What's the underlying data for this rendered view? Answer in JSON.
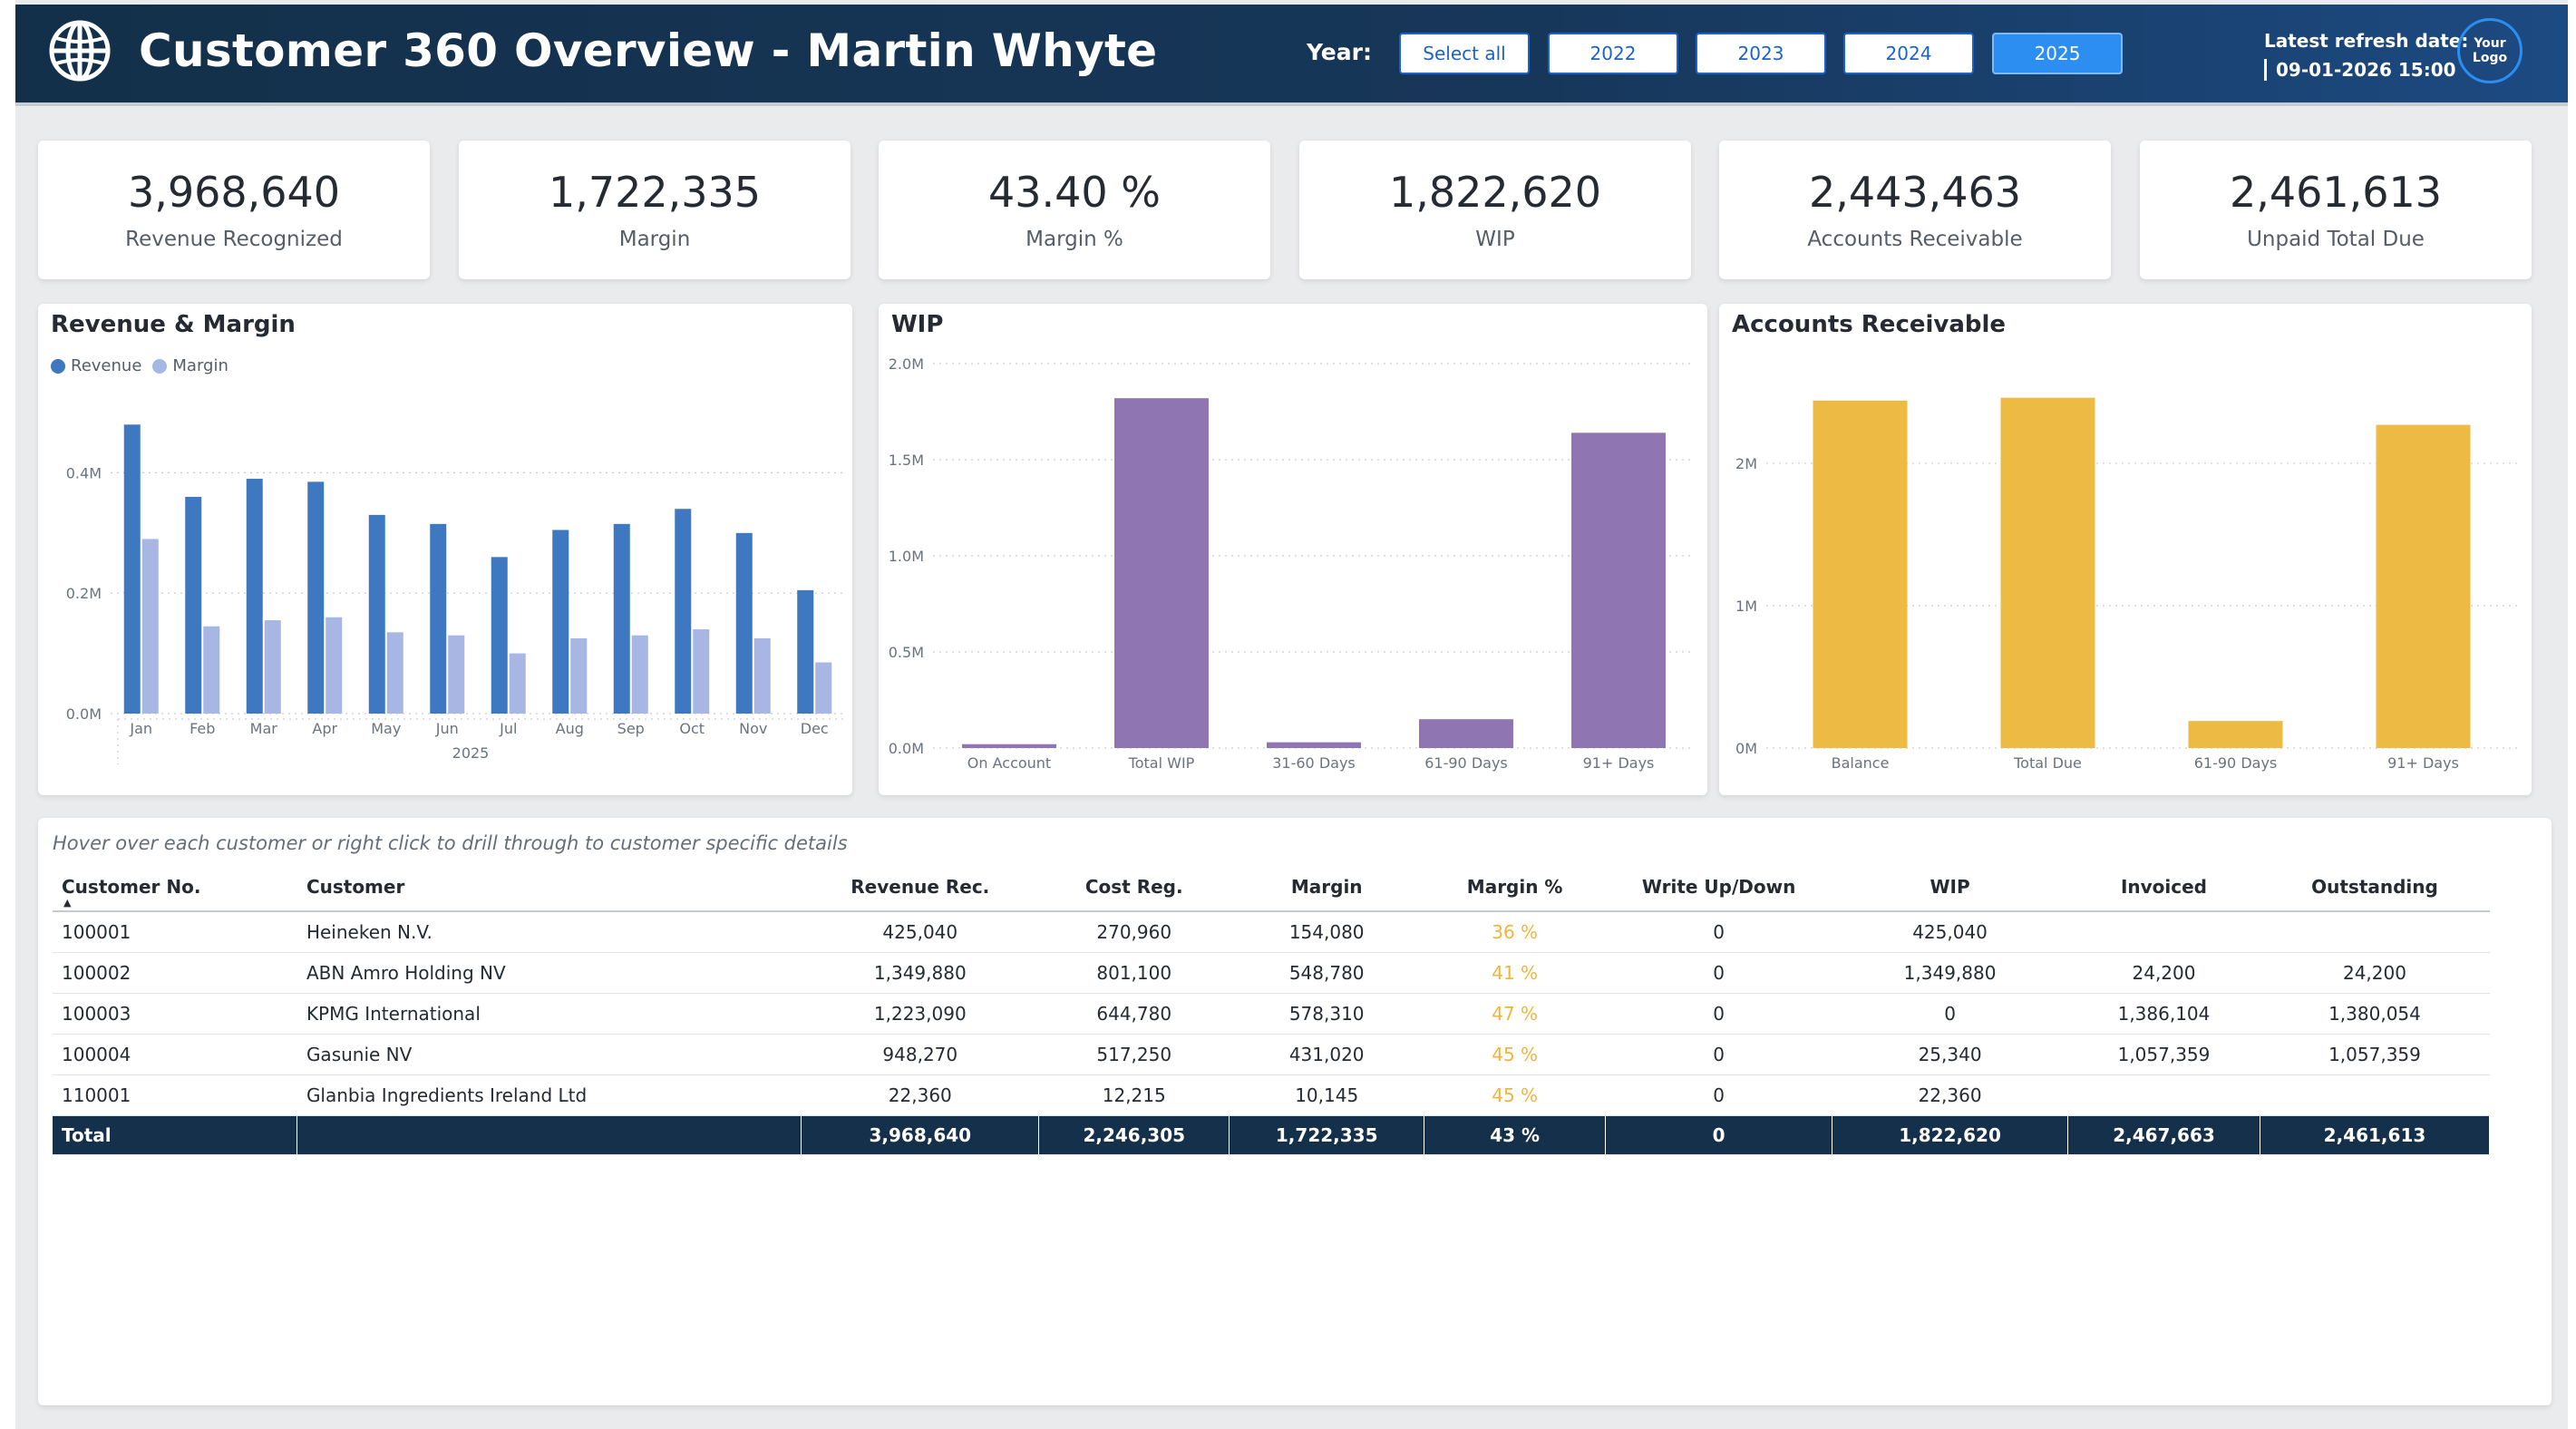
{
  "header": {
    "title": "Customer 360 Overview - Martin Whyte",
    "year_label": "Year:",
    "year_buttons": [
      "Select all",
      "2022",
      "2023",
      "2024",
      "2025"
    ],
    "selected_year": "2025",
    "refresh_label": "Latest refresh date:",
    "refresh_value": "09-01-2026 15:00",
    "logo_text": "Your Logo"
  },
  "kpis": [
    {
      "value": "3,968,640",
      "label": "Revenue Recognized"
    },
    {
      "value": "1,722,335",
      "label": "Margin"
    },
    {
      "value": "43.40 %",
      "label": "Margin %"
    },
    {
      "value": "1,822,620",
      "label": "WIP"
    },
    {
      "value": "2,443,463",
      "label": "Accounts Receivable"
    },
    {
      "value": "2,461,613",
      "label": "Unpaid Total Due"
    }
  ],
  "chart_data": [
    {
      "type": "bar",
      "title": "Revenue & Margin",
      "categories": [
        "Jan",
        "Feb",
        "Mar",
        "Apr",
        "May",
        "Jun",
        "Jul",
        "Aug",
        "Sep",
        "Oct",
        "Nov",
        "Dec"
      ],
      "x_group_label": "2025",
      "series": [
        {
          "name": "Revenue",
          "values": [
            0.48,
            0.36,
            0.39,
            0.385,
            0.33,
            0.315,
            0.26,
            0.305,
            0.315,
            0.34,
            0.3,
            0.205
          ]
        },
        {
          "name": "Margin",
          "values": [
            0.29,
            0.145,
            0.155,
            0.16,
            0.135,
            0.13,
            0.1,
            0.125,
            0.13,
            0.14,
            0.125,
            0.085
          ]
        }
      ],
      "yticks": [
        "0.0M",
        "0.2M",
        "0.4M"
      ],
      "ylim": [
        0,
        0.5
      ],
      "colors": [
        "#3d78c1",
        "#a7b6e2"
      ],
      "grid": true,
      "legend": "top-left"
    },
    {
      "type": "bar",
      "title": "WIP",
      "categories": [
        "On Account",
        "Total WIP",
        "31-60 Days",
        "61-90 Days",
        "91+ Days"
      ],
      "values": [
        0.02,
        1.82,
        0.03,
        0.15,
        1.64
      ],
      "yticks": [
        "0.0M",
        "0.5M",
        "1.0M",
        "1.5M",
        "2.0M"
      ],
      "ylim": [
        0,
        2.0
      ],
      "color": "#8f76b2",
      "grid": true
    },
    {
      "type": "bar",
      "title": "Accounts Receivable",
      "categories": [
        "Balance",
        "Total Due",
        "61-90 Days",
        "91+ Days"
      ],
      "values": [
        2.44,
        2.46,
        0.19,
        2.27
      ],
      "yticks": [
        "0M",
        "1M",
        "2M"
      ],
      "ylim": [
        0,
        2.7
      ],
      "color": "#edba44",
      "grid": true
    }
  ],
  "table": {
    "hint": "Hover over each customer or right click to drill through to customer specific details",
    "columns": [
      "Customer No.",
      "Customer",
      "Revenue Rec.",
      "Cost Reg.",
      "Margin",
      "Margin %",
      "Write Up/Down",
      "WIP",
      "Invoiced",
      "Outstanding"
    ],
    "rows": [
      [
        "100001",
        "Heineken N.V.",
        "425,040",
        "270,960",
        "154,080",
        "36 %",
        "0",
        "425,040",
        "",
        ""
      ],
      [
        "100002",
        "ABN Amro Holding NV",
        "1,349,880",
        "801,100",
        "548,780",
        "41 %",
        "0",
        "1,349,880",
        "24,200",
        "24,200"
      ],
      [
        "100003",
        "KPMG International",
        "1,223,090",
        "644,780",
        "578,310",
        "47 %",
        "0",
        "0",
        "1,386,104",
        "1,380,054"
      ],
      [
        "100004",
        "Gasunie NV",
        "948,270",
        "517,250",
        "431,020",
        "45 %",
        "0",
        "25,340",
        "1,057,359",
        "1,057,359"
      ],
      [
        "110001",
        "Glanbia Ingredients Ireland Ltd",
        "22,360",
        "12,215",
        "10,145",
        "45 %",
        "0",
        "22,360",
        "",
        ""
      ]
    ],
    "total": [
      "Total",
      "",
      "3,968,640",
      "2,246,305",
      "1,722,335",
      "43 %",
      "0",
      "1,822,620",
      "2,467,663",
      "2,461,613"
    ]
  }
}
